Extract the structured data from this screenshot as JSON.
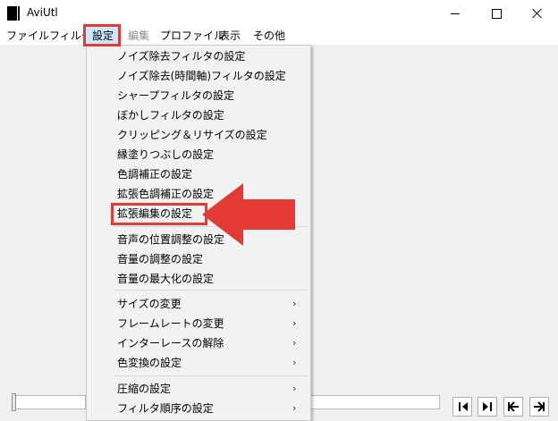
{
  "window": {
    "title": "AviUtl"
  },
  "menubar": {
    "items": [
      {
        "label": "ファイル"
      },
      {
        "label": "フィルタ"
      },
      {
        "label": "設定"
      },
      {
        "label": "編集"
      },
      {
        "label": "プロファイル"
      },
      {
        "label": "表示"
      },
      {
        "label": "その他"
      }
    ]
  },
  "dropdown": {
    "items": [
      {
        "label": "ノイズ除去フィルタの設定",
        "submenu": false
      },
      {
        "label": "ノイズ除去(時間軸)フィルタの設定",
        "submenu": false
      },
      {
        "label": "シャープフィルタの設定",
        "submenu": false
      },
      {
        "label": "ぼかしフィルタの設定",
        "submenu": false
      },
      {
        "label": "クリッピング＆リサイズの設定",
        "submenu": false
      },
      {
        "label": "縁塗りつぶしの設定",
        "submenu": false
      },
      {
        "label": "色調補正の設定",
        "submenu": false
      },
      {
        "label": "拡張色調補正の設定",
        "submenu": false
      },
      {
        "label": "拡張編集の設定",
        "submenu": false
      },
      {
        "label": "音声の位置調整の設定",
        "submenu": false
      },
      {
        "label": "音量の調整の設定",
        "submenu": false
      },
      {
        "label": "音量の最大化の設定",
        "submenu": false
      },
      {
        "label": "サイズの変更",
        "submenu": true
      },
      {
        "label": "フレームレートの変更",
        "submenu": true
      },
      {
        "label": "インターレースの解除",
        "submenu": true
      },
      {
        "label": "色変換の設定",
        "submenu": true
      },
      {
        "label": "圧縮の設定",
        "submenu": true
      },
      {
        "label": "フィルタ順序の設定",
        "submenu": true
      }
    ],
    "submenu_glyph": "›"
  },
  "colors": {
    "highlight_red": "#e53935",
    "menu_selected": "#cce8ff"
  }
}
